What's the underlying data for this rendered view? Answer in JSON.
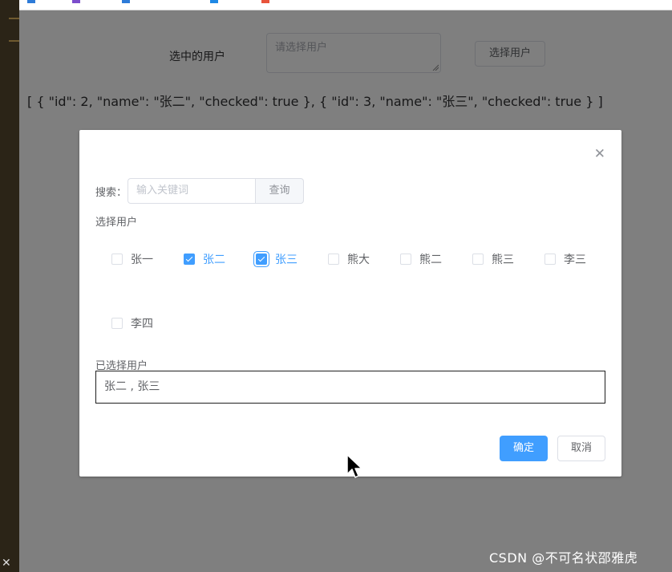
{
  "page": {
    "selected_users_label": "选中的用户",
    "textarea_placeholder": "请选择用户",
    "select_user_button": "选择用户",
    "json_output": "[ { \"id\": 2, \"name\": \"张二\", \"checked\": true }, { \"id\": 3, \"name\": \"张三\", \"checked\": true } ]"
  },
  "dialog": {
    "search_label": "搜索：",
    "search_placeholder": "输入关键词",
    "search_button": "查询",
    "select_section_title": "选择用户",
    "users": [
      {
        "label": "张一",
        "checked": false
      },
      {
        "label": "张二",
        "checked": true
      },
      {
        "label": "张三",
        "checked": true
      },
      {
        "label": "熊大",
        "checked": false
      },
      {
        "label": "熊二",
        "checked": false
      },
      {
        "label": "熊三",
        "checked": false
      },
      {
        "label": "李三",
        "checked": false
      },
      {
        "label": "李四",
        "checked": false
      }
    ],
    "chosen_section_title": "已选择用户",
    "chosen_value": "张二 , 张三",
    "confirm_button": "确定",
    "cancel_button": "取消"
  },
  "watermark": "CSDN @不可名状邵雅虎",
  "colors": {
    "primary": "#409eff",
    "overlay": "#808080",
    "editor_strip": "#2b2417"
  },
  "icons": {
    "dialog_close": "close-icon",
    "cursor": "mouse-pointer-icon",
    "checkbox_check": "check-icon"
  }
}
